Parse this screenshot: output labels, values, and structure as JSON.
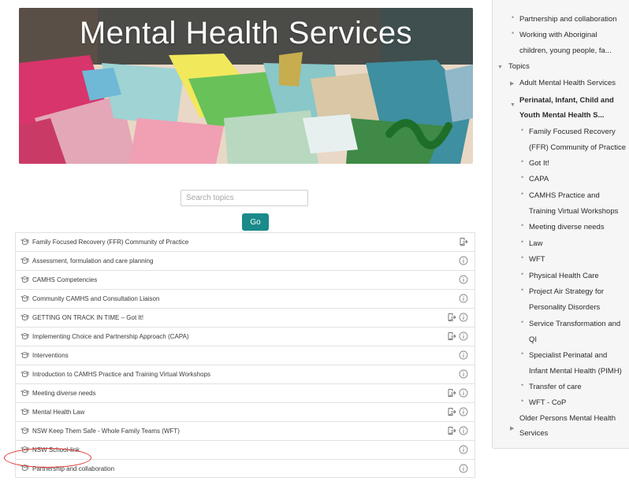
{
  "banner": {
    "title": "Mental Health Services"
  },
  "search": {
    "placeholder": "Search topics",
    "go_label": "Go"
  },
  "topics": [
    {
      "label": "Family Focused Recovery (FFR) Community of Practice",
      "enrol": true,
      "info": false
    },
    {
      "label": "Assessment, formulation and care planning",
      "enrol": false,
      "info": true
    },
    {
      "label": "CAMHS Competencies",
      "enrol": false,
      "info": true
    },
    {
      "label": "Community CAMHS and Consultation Liaison",
      "enrol": false,
      "info": true
    },
    {
      "label": "GETTING ON TRACK IN TIME – Got It!",
      "enrol": true,
      "info": true
    },
    {
      "label": "Implementing Choice and Partnership Approach (CAPA)",
      "enrol": true,
      "info": true
    },
    {
      "label": "Interventions",
      "enrol": false,
      "info": true
    },
    {
      "label": "Introduction to CAMHS Practice and Training Virtual Workshops",
      "enrol": false,
      "info": true
    },
    {
      "label": "Meeting diverse needs",
      "enrol": true,
      "info": true
    },
    {
      "label": "Mental Health Law",
      "enrol": true,
      "info": true
    },
    {
      "label": "NSW Keep Them Safe - Whole Family Teams (WFT)",
      "enrol": true,
      "info": true
    },
    {
      "label": "NSW School-link",
      "enrol": false,
      "info": true
    },
    {
      "label": "Partnership and collaboration",
      "enrol": false,
      "info": true
    }
  ],
  "nav": {
    "top_items": [
      "Partnership and collaboration",
      "Working with Aboriginal",
      "children, young people, fa..."
    ],
    "topics_label": "Topics",
    "adult": "Adult Mental Health Services",
    "perinatal_line1": "Perinatal, Infant, Child and",
    "perinatal_line2": "Youth Mental Health S...",
    "sub_items": [
      "Family Focused Recovery",
      "(FFR) Community of Practice",
      "Got It!",
      "CAPA",
      "CAMHS Practice and",
      "Training Virtual Workshops",
      "Meeting diverse needs",
      "Law",
      "WFT",
      "Physical Health Care",
      "Project Air Strategy for",
      "Personality Disorders",
      "Service Transformation and",
      "QI",
      "Specialist Perinatal and",
      "Infant Mental Health (PIMH)",
      "Transfer of care",
      "WFT - CoP"
    ],
    "older_line1": "Older Persons Mental Health",
    "older_line2": "Services"
  },
  "colors": {
    "accent": "#1a8a8a",
    "highlight": "#e0302b",
    "panel_bg": "#f6f6f6"
  },
  "icons": {
    "course": "course-icon",
    "enrol": "self-enrol-icon",
    "info": "info-icon"
  }
}
